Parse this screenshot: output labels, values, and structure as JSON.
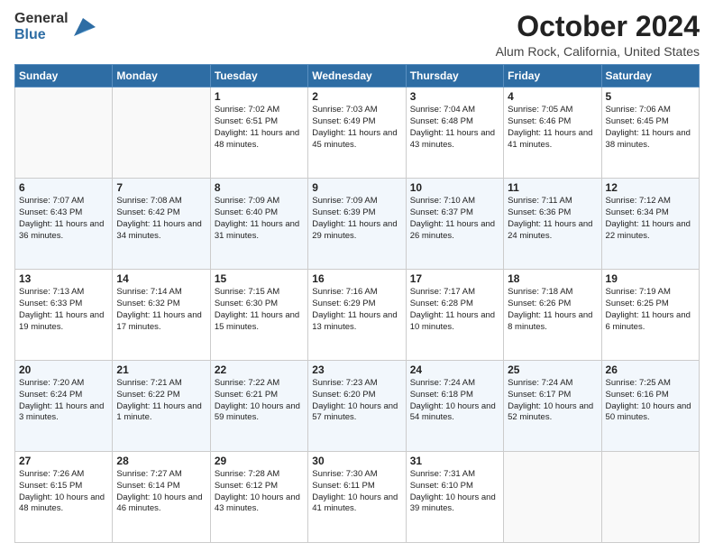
{
  "header": {
    "logo_general": "General",
    "logo_blue": "Blue",
    "month_title": "October 2024",
    "location": "Alum Rock, California, United States"
  },
  "days_of_week": [
    "Sunday",
    "Monday",
    "Tuesday",
    "Wednesday",
    "Thursday",
    "Friday",
    "Saturday"
  ],
  "weeks": [
    [
      {
        "day": "",
        "sunrise": "",
        "sunset": "",
        "daylight": "",
        "empty": true
      },
      {
        "day": "",
        "sunrise": "",
        "sunset": "",
        "daylight": "",
        "empty": true
      },
      {
        "day": "1",
        "sunrise": "Sunrise: 7:02 AM",
        "sunset": "Sunset: 6:51 PM",
        "daylight": "Daylight: 11 hours and 48 minutes."
      },
      {
        "day": "2",
        "sunrise": "Sunrise: 7:03 AM",
        "sunset": "Sunset: 6:49 PM",
        "daylight": "Daylight: 11 hours and 45 minutes."
      },
      {
        "day": "3",
        "sunrise": "Sunrise: 7:04 AM",
        "sunset": "Sunset: 6:48 PM",
        "daylight": "Daylight: 11 hours and 43 minutes."
      },
      {
        "day": "4",
        "sunrise": "Sunrise: 7:05 AM",
        "sunset": "Sunset: 6:46 PM",
        "daylight": "Daylight: 11 hours and 41 minutes."
      },
      {
        "day": "5",
        "sunrise": "Sunrise: 7:06 AM",
        "sunset": "Sunset: 6:45 PM",
        "daylight": "Daylight: 11 hours and 38 minutes."
      }
    ],
    [
      {
        "day": "6",
        "sunrise": "Sunrise: 7:07 AM",
        "sunset": "Sunset: 6:43 PM",
        "daylight": "Daylight: 11 hours and 36 minutes."
      },
      {
        "day": "7",
        "sunrise": "Sunrise: 7:08 AM",
        "sunset": "Sunset: 6:42 PM",
        "daylight": "Daylight: 11 hours and 34 minutes."
      },
      {
        "day": "8",
        "sunrise": "Sunrise: 7:09 AM",
        "sunset": "Sunset: 6:40 PM",
        "daylight": "Daylight: 11 hours and 31 minutes."
      },
      {
        "day": "9",
        "sunrise": "Sunrise: 7:09 AM",
        "sunset": "Sunset: 6:39 PM",
        "daylight": "Daylight: 11 hours and 29 minutes."
      },
      {
        "day": "10",
        "sunrise": "Sunrise: 7:10 AM",
        "sunset": "Sunset: 6:37 PM",
        "daylight": "Daylight: 11 hours and 26 minutes."
      },
      {
        "day": "11",
        "sunrise": "Sunrise: 7:11 AM",
        "sunset": "Sunset: 6:36 PM",
        "daylight": "Daylight: 11 hours and 24 minutes."
      },
      {
        "day": "12",
        "sunrise": "Sunrise: 7:12 AM",
        "sunset": "Sunset: 6:34 PM",
        "daylight": "Daylight: 11 hours and 22 minutes."
      }
    ],
    [
      {
        "day": "13",
        "sunrise": "Sunrise: 7:13 AM",
        "sunset": "Sunset: 6:33 PM",
        "daylight": "Daylight: 11 hours and 19 minutes."
      },
      {
        "day": "14",
        "sunrise": "Sunrise: 7:14 AM",
        "sunset": "Sunset: 6:32 PM",
        "daylight": "Daylight: 11 hours and 17 minutes."
      },
      {
        "day": "15",
        "sunrise": "Sunrise: 7:15 AM",
        "sunset": "Sunset: 6:30 PM",
        "daylight": "Daylight: 11 hours and 15 minutes."
      },
      {
        "day": "16",
        "sunrise": "Sunrise: 7:16 AM",
        "sunset": "Sunset: 6:29 PM",
        "daylight": "Daylight: 11 hours and 13 minutes."
      },
      {
        "day": "17",
        "sunrise": "Sunrise: 7:17 AM",
        "sunset": "Sunset: 6:28 PM",
        "daylight": "Daylight: 11 hours and 10 minutes."
      },
      {
        "day": "18",
        "sunrise": "Sunrise: 7:18 AM",
        "sunset": "Sunset: 6:26 PM",
        "daylight": "Daylight: 11 hours and 8 minutes."
      },
      {
        "day": "19",
        "sunrise": "Sunrise: 7:19 AM",
        "sunset": "Sunset: 6:25 PM",
        "daylight": "Daylight: 11 hours and 6 minutes."
      }
    ],
    [
      {
        "day": "20",
        "sunrise": "Sunrise: 7:20 AM",
        "sunset": "Sunset: 6:24 PM",
        "daylight": "Daylight: 11 hours and 3 minutes."
      },
      {
        "day": "21",
        "sunrise": "Sunrise: 7:21 AM",
        "sunset": "Sunset: 6:22 PM",
        "daylight": "Daylight: 11 hours and 1 minute."
      },
      {
        "day": "22",
        "sunrise": "Sunrise: 7:22 AM",
        "sunset": "Sunset: 6:21 PM",
        "daylight": "Daylight: 10 hours and 59 minutes."
      },
      {
        "day": "23",
        "sunrise": "Sunrise: 7:23 AM",
        "sunset": "Sunset: 6:20 PM",
        "daylight": "Daylight: 10 hours and 57 minutes."
      },
      {
        "day": "24",
        "sunrise": "Sunrise: 7:24 AM",
        "sunset": "Sunset: 6:18 PM",
        "daylight": "Daylight: 10 hours and 54 minutes."
      },
      {
        "day": "25",
        "sunrise": "Sunrise: 7:24 AM",
        "sunset": "Sunset: 6:17 PM",
        "daylight": "Daylight: 10 hours and 52 minutes."
      },
      {
        "day": "26",
        "sunrise": "Sunrise: 7:25 AM",
        "sunset": "Sunset: 6:16 PM",
        "daylight": "Daylight: 10 hours and 50 minutes."
      }
    ],
    [
      {
        "day": "27",
        "sunrise": "Sunrise: 7:26 AM",
        "sunset": "Sunset: 6:15 PM",
        "daylight": "Daylight: 10 hours and 48 minutes."
      },
      {
        "day": "28",
        "sunrise": "Sunrise: 7:27 AM",
        "sunset": "Sunset: 6:14 PM",
        "daylight": "Daylight: 10 hours and 46 minutes."
      },
      {
        "day": "29",
        "sunrise": "Sunrise: 7:28 AM",
        "sunset": "Sunset: 6:12 PM",
        "daylight": "Daylight: 10 hours and 43 minutes."
      },
      {
        "day": "30",
        "sunrise": "Sunrise: 7:30 AM",
        "sunset": "Sunset: 6:11 PM",
        "daylight": "Daylight: 10 hours and 41 minutes."
      },
      {
        "day": "31",
        "sunrise": "Sunrise: 7:31 AM",
        "sunset": "Sunset: 6:10 PM",
        "daylight": "Daylight: 10 hours and 39 minutes."
      },
      {
        "day": "",
        "sunrise": "",
        "sunset": "",
        "daylight": "",
        "empty": true
      },
      {
        "day": "",
        "sunrise": "",
        "sunset": "",
        "daylight": "",
        "empty": true
      }
    ]
  ]
}
